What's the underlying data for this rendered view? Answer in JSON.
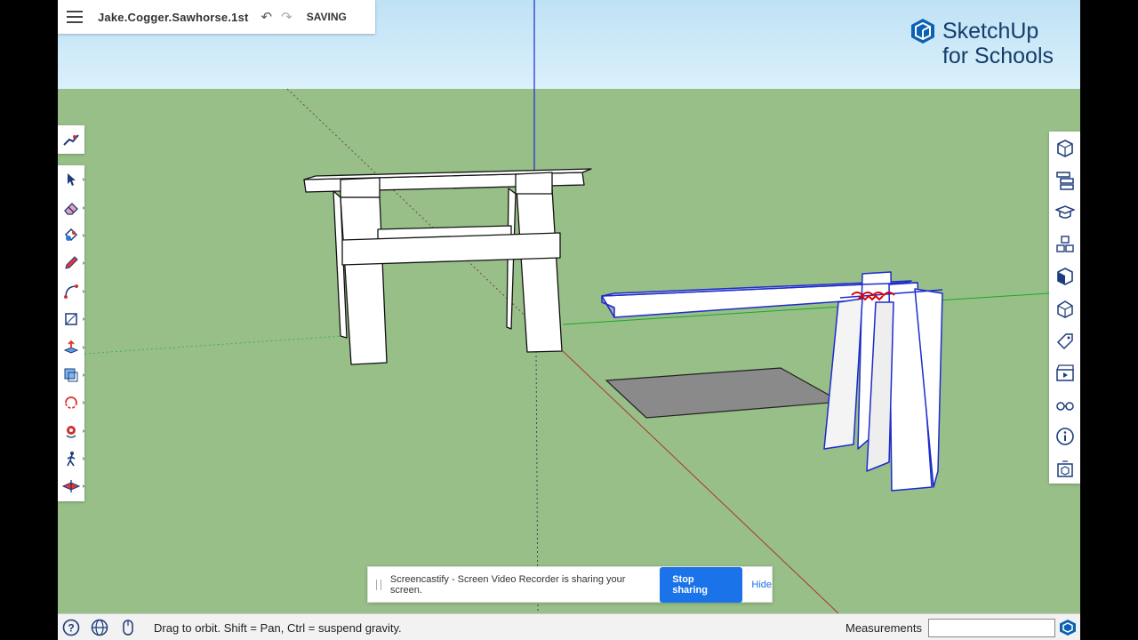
{
  "title_bar": {
    "filename": "Jake.Cogger.Sawhorse.1st",
    "save_status": "SAVING"
  },
  "brand": {
    "name": "SketchUp",
    "subtitle": "for Schools",
    "color": "#133d6b"
  },
  "left_toolbar": {
    "top_icon": "instructor-icon",
    "tools": [
      "select-icon",
      "eraser-icon",
      "paint-bucket-icon",
      "pencil-icon",
      "arc-icon",
      "rectangle-icon",
      "push-pull-icon",
      "offset-icon",
      "rotate-icon",
      "orbit-icon",
      "walk-icon",
      "section-plane-icon"
    ]
  },
  "right_panel": {
    "icons": [
      "entity-info-icon",
      "outliner-icon",
      "instructor-icon",
      "components-icon",
      "materials-icon",
      "styles-icon",
      "tags-icon",
      "scenes-icon",
      "display-icon",
      "info-icon",
      "3d-warehouse-icon"
    ]
  },
  "screen_share": {
    "message": "Screencastify - Screen Video Recorder is sharing your screen.",
    "stop_label": "Stop sharing",
    "hide_label": "Hide",
    "accent": "#1a73e8"
  },
  "status_bar": {
    "hint": "Drag to orbit. Shift = Pan, Ctrl = suspend gravity.",
    "measurements_label": "Measurements",
    "measurements_value": ""
  },
  "colors": {
    "sky": "#d4ecf9",
    "ground": "#98bf88",
    "selection": "#1d2ccc"
  }
}
